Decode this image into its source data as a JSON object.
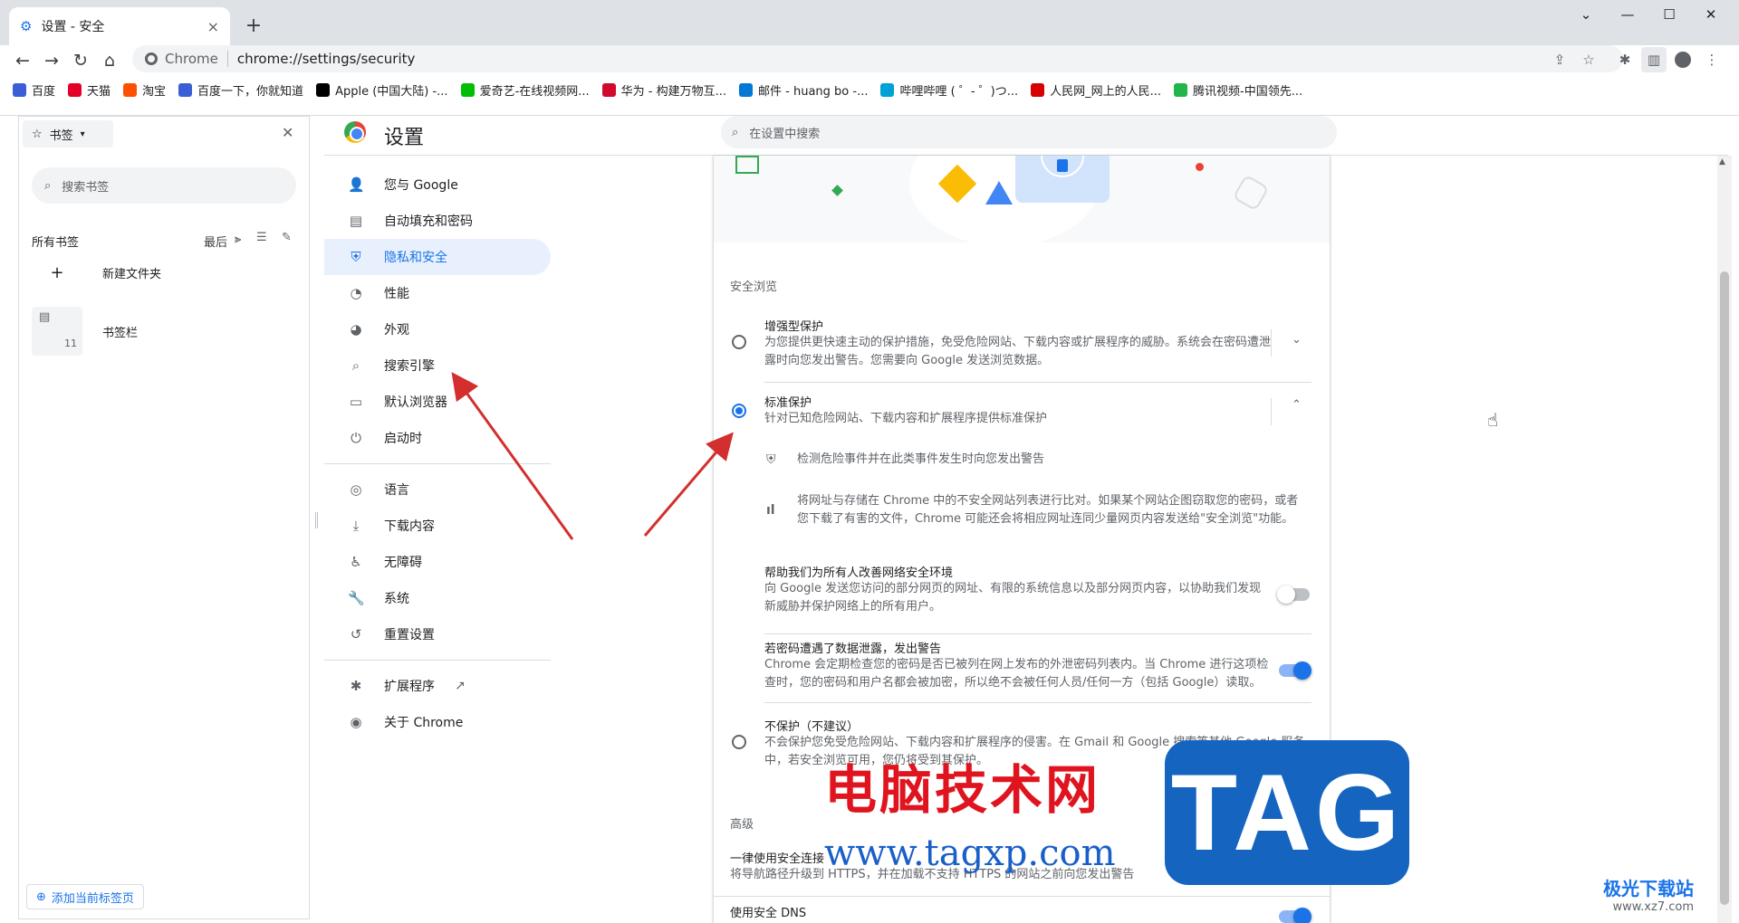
{
  "tab": {
    "title": "设置 - 安全",
    "close": "×",
    "new": "+"
  },
  "window": {
    "minimize": "—",
    "maximize": "☐",
    "close": "✕",
    "dropdown": "⌄"
  },
  "nav": {
    "back": "←",
    "forward": "→",
    "reload": "↻",
    "home": "⌂"
  },
  "omnibox": {
    "site_label": "Chrome",
    "url": "chrome://settings/security"
  },
  "bookmarks_bar": [
    {
      "label": "百度",
      "color": "#3b5ed6"
    },
    {
      "label": "天猫",
      "color": "#e4002b"
    },
    {
      "label": "淘宝",
      "color": "#ff5000"
    },
    {
      "label": "百度一下，你就知道",
      "color": "#3b5ed6"
    },
    {
      "label": "Apple (中国大陆) -...",
      "color": "#000000"
    },
    {
      "label": "爱奇艺-在线视频网...",
      "color": "#00be06"
    },
    {
      "label": "华为 - 构建万物互...",
      "color": "#cf0a2c"
    },
    {
      "label": "邮件 - huang bo -...",
      "color": "#0078d4"
    },
    {
      "label": "哔哩哔哩 ( ゜- ゜)つ...",
      "color": "#00a1d6"
    },
    {
      "label": "人民网_网上的人民...",
      "color": "#d60000"
    },
    {
      "label": "腾讯视频-中国领先...",
      "color": "#20b64a"
    }
  ],
  "side_panel": {
    "selector": "书签",
    "search_placeholder": "搜索书签",
    "all_bookmarks": "所有书签",
    "sort": "最后",
    "new_folder": "新建文件夹",
    "folder_name": "书签栏",
    "folder_count": "11",
    "add_current": "添加当前标签页"
  },
  "settings": {
    "title": "设置",
    "search_placeholder": "在设置中搜索",
    "nav_items": [
      {
        "label": "您与 Google",
        "icon": "person-icon"
      },
      {
        "label": "自动填充和密码",
        "icon": "clipboard-icon"
      },
      {
        "label": "隐私和安全",
        "icon": "shield-icon",
        "active": true
      },
      {
        "label": "性能",
        "icon": "speedometer-icon"
      },
      {
        "label": "外观",
        "icon": "palette-icon"
      },
      {
        "label": "搜索引擎",
        "icon": "search-icon"
      },
      {
        "label": "默认浏览器",
        "icon": "browser-icon"
      },
      {
        "label": "启动时",
        "icon": "power-icon"
      }
    ],
    "nav_items2": [
      {
        "label": "语言",
        "icon": "globe-icon"
      },
      {
        "label": "下载内容",
        "icon": "download-icon"
      },
      {
        "label": "无障碍",
        "icon": "accessibility-icon"
      },
      {
        "label": "系统",
        "icon": "wrench-icon"
      },
      {
        "label": "重置设置",
        "icon": "history-icon"
      }
    ],
    "nav_items3": [
      {
        "label": "扩展程序",
        "icon": "puzzle-icon"
      },
      {
        "label": "关于 Chrome",
        "icon": "chrome-icon"
      }
    ]
  },
  "security": {
    "section_title": "安全浏览",
    "enhanced": {
      "title": "增强型保护",
      "desc": "为您提供更快速主动的保护措施，免受危险网站、下载内容或扩展程序的威胁。系统会在密码遭泄露时向您发出警告。您需要向 Google 发送浏览数据。"
    },
    "standard": {
      "title": "标准保护",
      "desc": "针对已知危险网站、下载内容和扩展程序提供标准保护",
      "bullet1": "检测危险事件并在此类事件发生时向您发出警告",
      "bullet2": "将网址与存储在 Chrome 中的不安全网站列表进行比对。如果某个网站企图窃取您的密码，或者您下载了有害的文件，Chrome 可能还会将相应网址连同少量网页内容发送给\"安全浏览\"功能。"
    },
    "help_improve": {
      "title": "帮助我们为所有人改善网络安全环境",
      "desc": "向 Google 发送您访问的部分网页的网址、有限的系统信息以及部分网页内容，以协助我们发现新威胁并保护网络上的所有用户。",
      "on": false
    },
    "password_warn": {
      "title": "若密码遭遇了数据泄露，发出警告",
      "desc": "Chrome 会定期检查您的密码是否已被列在网上发布的外泄密码列表内。当 Chrome 进行这项检查时，您的密码和用户名都会被加密，所以绝不会被任何人员/任何一方（包括 Google）读取。",
      "on": true
    },
    "no_protection": {
      "title": "不保护（不建议）",
      "desc": "不会保护您免受危险网站、下载内容和扩展程序的侵害。在 Gmail 和 Google 搜索等其他 Google 服务中，若安全浏览可用，您仍将受到其保护。"
    },
    "advanced_title": "高级",
    "https": {
      "title": "一律使用安全连接",
      "desc": "将导航路径升级到 HTTPS，并在加载不支持 HTTPS 的网站之前向您发出警告",
      "on": true
    },
    "dns": {
      "title": "使用安全 DNS"
    }
  },
  "watermark": {
    "cn": "电脑技术网",
    "url": "www.tagxp.com",
    "tag": "TAG",
    "corner": "极光下载站",
    "corner_url": "www.xz7.com"
  }
}
